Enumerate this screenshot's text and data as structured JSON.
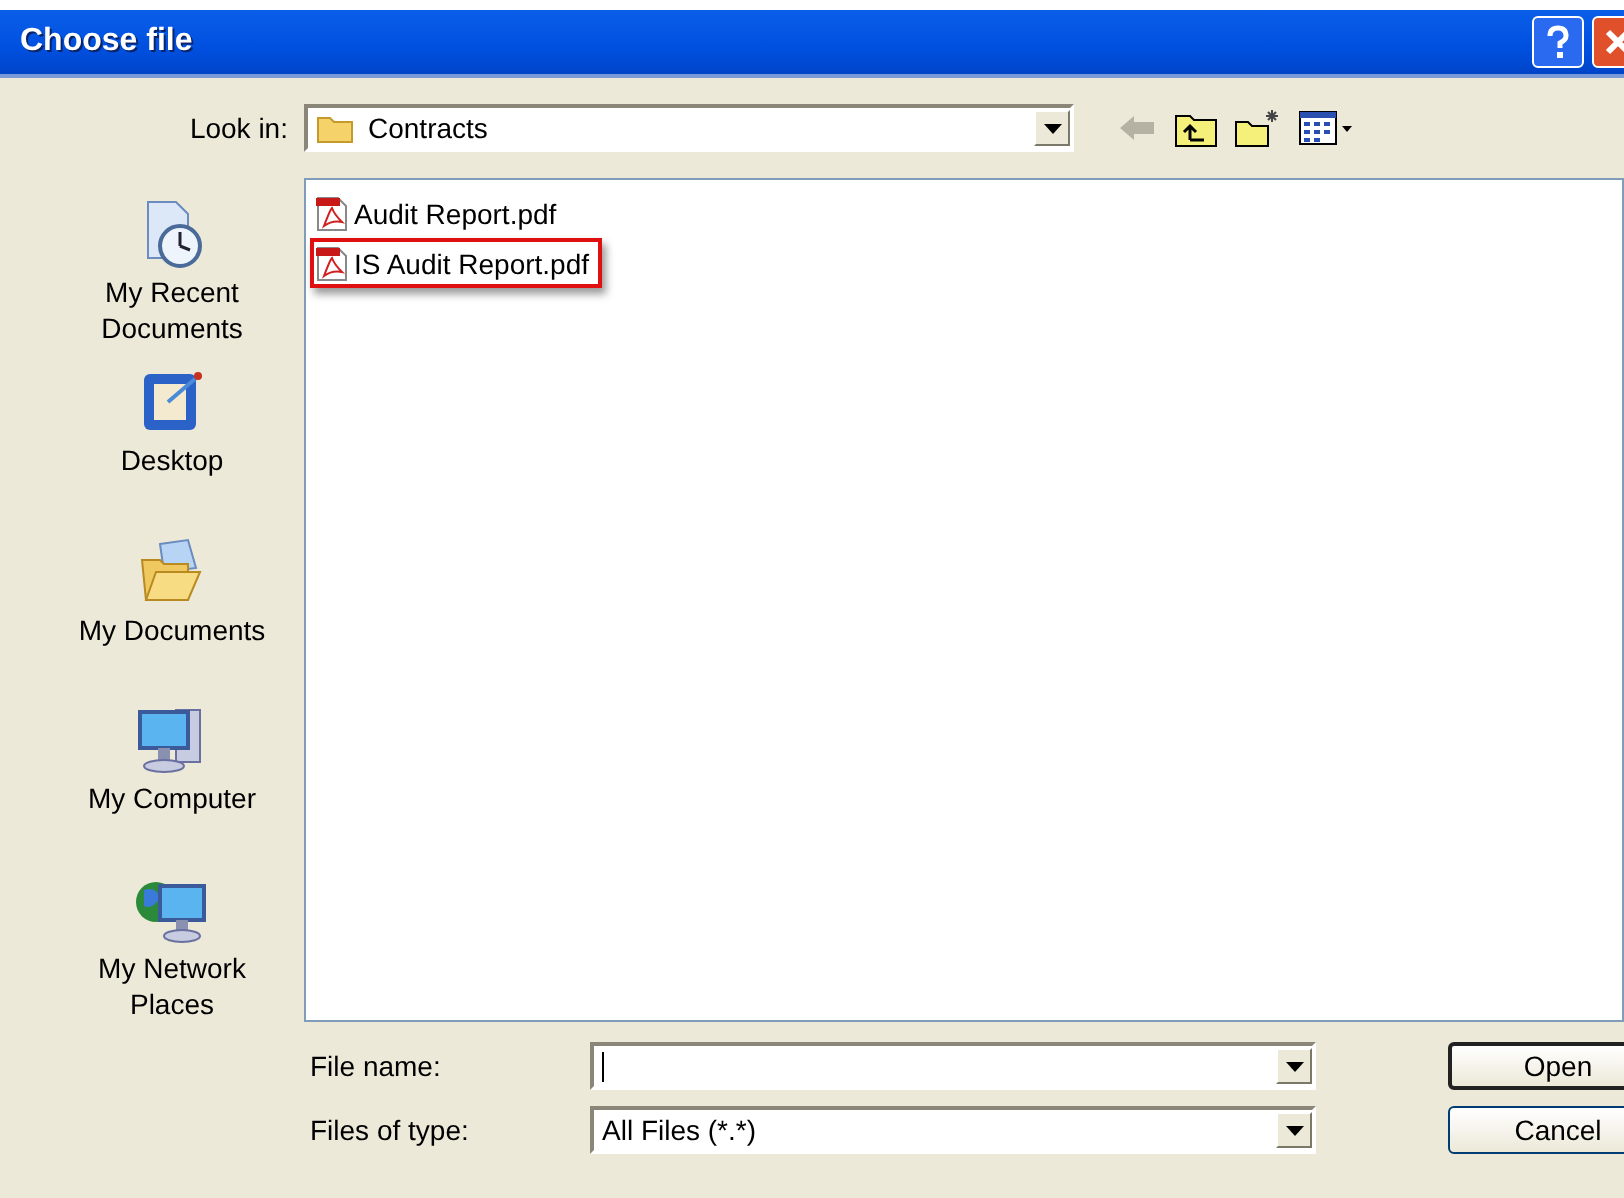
{
  "window": {
    "title": "Choose file"
  },
  "look_in": {
    "label": "Look in:",
    "value": "Contracts"
  },
  "toolbar": [
    {
      "kind": "back",
      "disabled": true
    },
    {
      "kind": "up",
      "disabled": false
    },
    {
      "kind": "new-folder",
      "disabled": false
    },
    {
      "kind": "views",
      "disabled": false
    }
  ],
  "places": [
    {
      "kind": "recent",
      "label": "My Recent Documents"
    },
    {
      "kind": "desktop",
      "label": "Desktop"
    },
    {
      "kind": "documents",
      "label": "My Documents"
    },
    {
      "kind": "computer",
      "label": "My Computer"
    },
    {
      "kind": "network",
      "label": "My Network Places"
    }
  ],
  "files": [
    {
      "name": "Audit Report.pdf",
      "highlighted": false
    },
    {
      "name": "IS Audit Report.pdf",
      "highlighted": true
    }
  ],
  "file_name": {
    "label": "File name:"
  },
  "file_type": {
    "label": "Files of type:",
    "value": "All Files (*.*)"
  },
  "buttons": [
    "Open",
    "Cancel"
  ]
}
